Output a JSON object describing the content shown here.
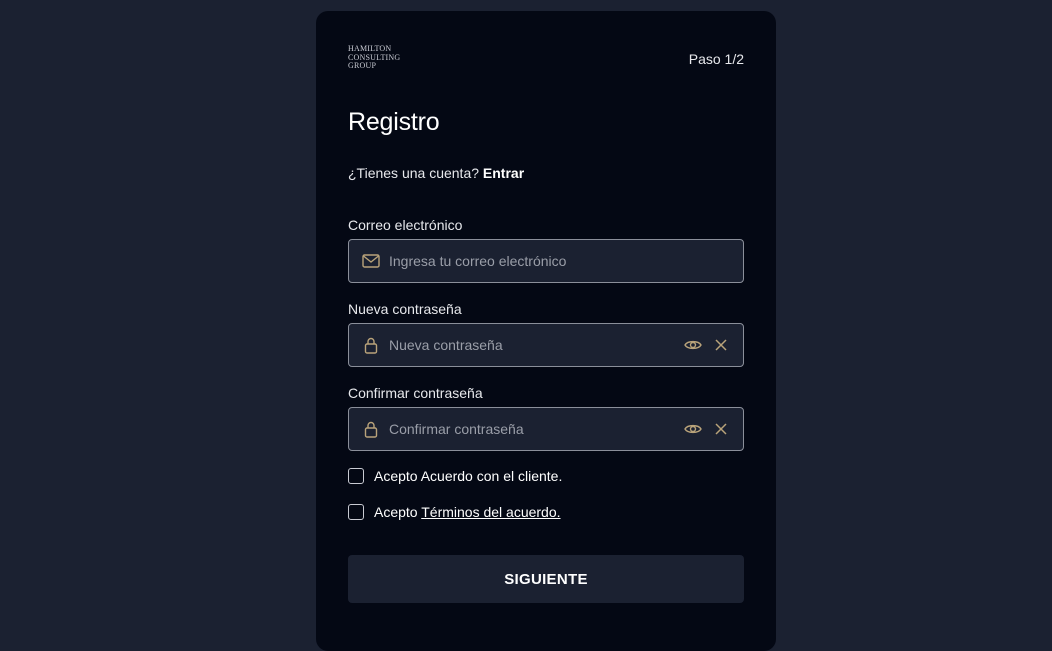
{
  "brand": {
    "logo_lines": [
      "HAMILTON",
      "CONSULTING",
      "GROUP"
    ]
  },
  "header": {
    "step": "Paso 1/2"
  },
  "form": {
    "title": "Registro",
    "account_prompt": "¿Tienes una cuenta?",
    "login_link": "Entrar",
    "email": {
      "label": "Correo electrónico",
      "placeholder": "Ingresa tu correo electrónico",
      "value": "",
      "icon": "mail-icon"
    },
    "new_password": {
      "label": "Nueva contraseña",
      "placeholder": "Nueva contraseña",
      "value": "",
      "icon": "lock-icon"
    },
    "confirm_password": {
      "label": "Confirmar contraseña",
      "placeholder": "Confirmar contraseña",
      "value": "",
      "icon": "lock-icon"
    },
    "checkbox_client": {
      "text": "Acepto Acuerdo con el cliente.",
      "checked": false
    },
    "checkbox_terms": {
      "prefix": "Acepto",
      "link": "Términos del acuerdo.",
      "checked": false
    },
    "submit_label": "SIGUIENTE"
  },
  "colors": {
    "page_background": "#1b2131",
    "card_background": "#040814",
    "input_background": "#1b2131",
    "icon_accent": "#b9a37a",
    "text": "#ffffff"
  }
}
